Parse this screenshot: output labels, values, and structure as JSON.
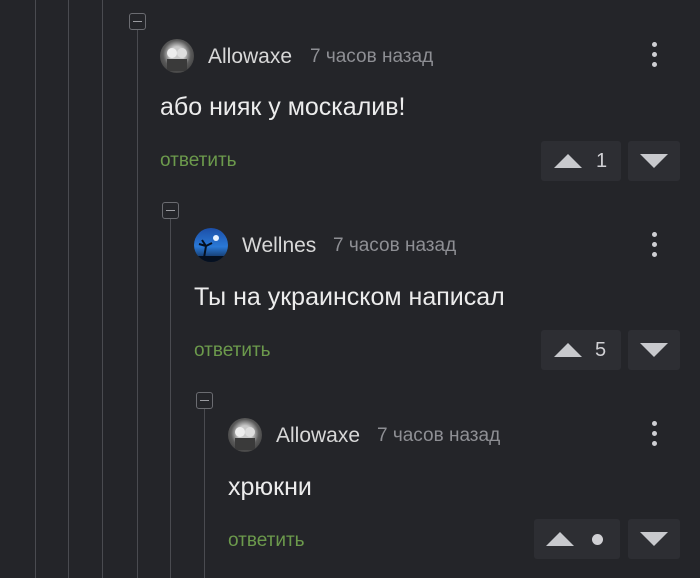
{
  "comments": [
    {
      "author": "Allowaxe",
      "time": "7 часов назад",
      "text": "або нияк у москалив!",
      "reply_label": "ответить",
      "score": "1",
      "avatar_icon": "user-photo-avatar"
    },
    {
      "author": "Wellnes",
      "time": "7 часов назад",
      "text": "Ты на украинском написал",
      "reply_label": "ответить",
      "score": "5",
      "avatar_icon": "night-palm-avatar"
    },
    {
      "author": "Allowaxe",
      "time": "7 часов назад",
      "text": "хрюкни",
      "reply_label": "ответить",
      "score": "",
      "avatar_icon": "user-photo-avatar"
    }
  ],
  "colors": {
    "background": "#242529",
    "reply_link": "#6c9a4c",
    "vote_box": "#2d2e33",
    "muted_text": "#8e8f94"
  }
}
